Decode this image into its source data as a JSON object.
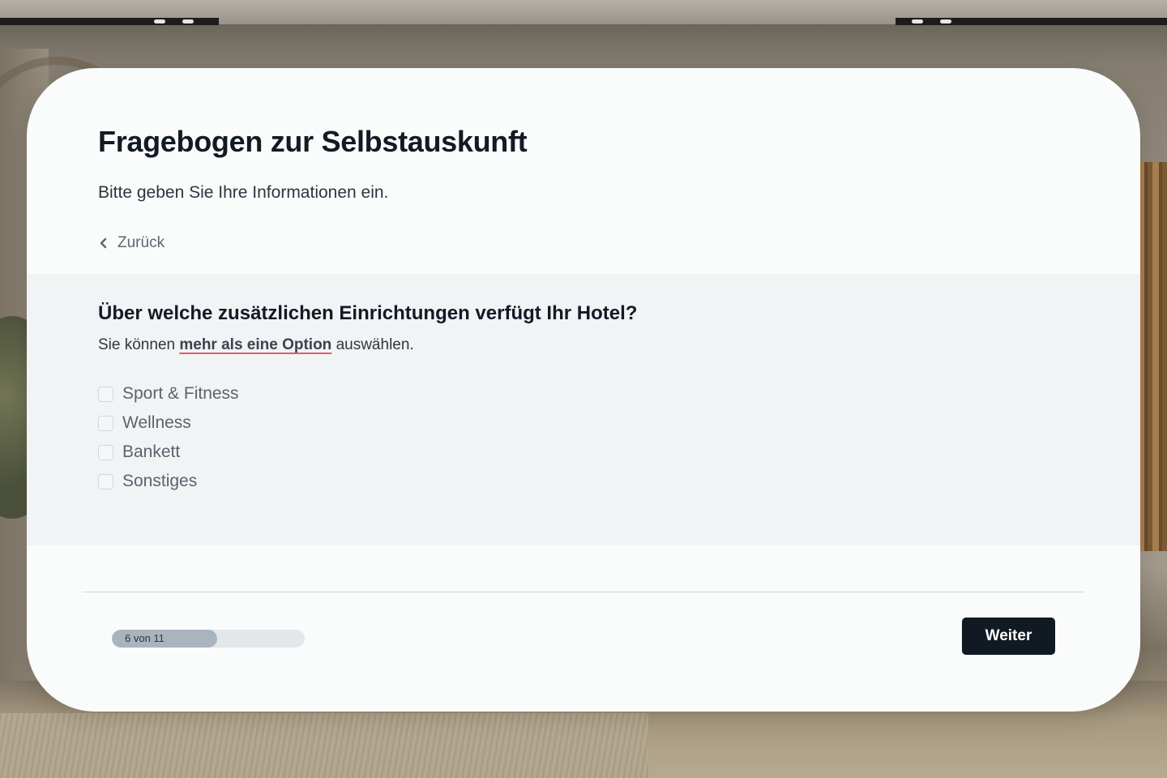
{
  "form": {
    "title": "Fragebogen zur Selbstauskunft",
    "subtitle": "Bitte geben Sie Ihre Informationen ein.",
    "back_label": "Zurück"
  },
  "question": {
    "title": "Über welche zusätzlichen Einrichtungen verfügt Ihr Hotel?",
    "hint_before": "Sie können ",
    "hint_emphasis": "mehr als eine Option",
    "hint_after": " auswählen.",
    "options": [
      {
        "label": "Sport & Fitness",
        "checked": false
      },
      {
        "label": "Wellness",
        "checked": false
      },
      {
        "label": "Bankett",
        "checked": false
      },
      {
        "label": "Sonstiges",
        "checked": false
      }
    ]
  },
  "progress": {
    "text": "6 von 11",
    "current": 6,
    "total": 11
  },
  "footer": {
    "next_label": "Weiter"
  },
  "colors": {
    "primary_button": "#111923",
    "progress_fill": "#a9b4bf",
    "hint_underline": "#e05a6a"
  }
}
